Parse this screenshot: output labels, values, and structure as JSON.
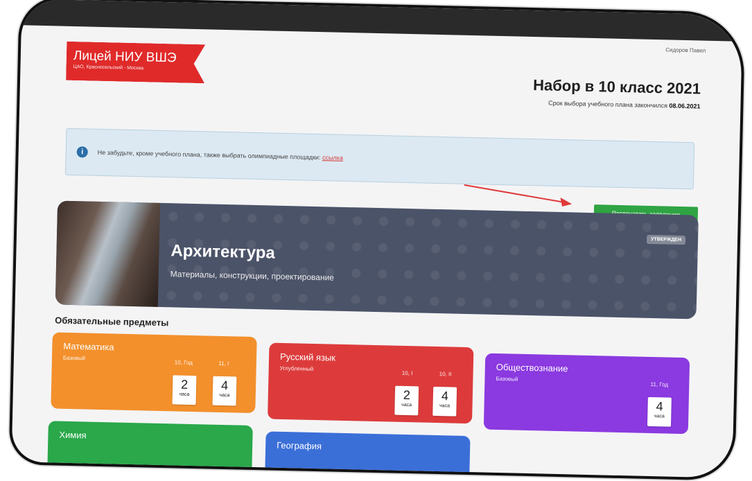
{
  "header": {
    "user_name": "Сидоров Павел",
    "logo_title": "Лицей НИУ ВШЭ",
    "logo_subtitle": "ЦАО, Красносельский - Москва",
    "title": "Набор в 10 класс 2021",
    "deadline_text": "Срок выбора учебного плана закончился",
    "deadline_date": "08.06.2021"
  },
  "notice": {
    "icon": "info-icon",
    "text": "Не забудьте, кроме учебного плана, также выбрать олимпиадные площадки:",
    "link": "ссылка"
  },
  "print_button": "Распечатать заявление",
  "banner": {
    "name": "Архитектура",
    "subtitle": "Материалы, конструкции, проектирование",
    "status": "УТВЕРЖДЕН"
  },
  "required_heading": "Обязательные предметы",
  "subjects": [
    {
      "name": "Математика",
      "level": "Базовый",
      "columns": [
        {
          "label": "10, Год",
          "hours": "2",
          "unit": "часа"
        },
        {
          "label": "11, I",
          "hours": "4",
          "unit": "часа"
        }
      ],
      "color": "#f3902c"
    },
    {
      "name": "Русский язык",
      "level": "Углубленный",
      "columns": [
        {
          "label": "10, I",
          "hours": "2",
          "unit": "часа"
        },
        {
          "label": "10, II",
          "hours": "4",
          "unit": "часа"
        }
      ],
      "color": "#dd3b3b"
    },
    {
      "name": "Обществознание",
      "level": "Базовый",
      "columns": [
        {
          "label": "11, Год",
          "hours": "4",
          "unit": "часа"
        }
      ],
      "color": "#8b39e0"
    },
    {
      "name": "Химия",
      "color": "#2aa84a"
    },
    {
      "name": "География",
      "color": "#3b6fd8"
    }
  ],
  "colors": {
    "accent": "#e02a2a",
    "print_button": "#2fa443",
    "banner": "#4b5368"
  }
}
